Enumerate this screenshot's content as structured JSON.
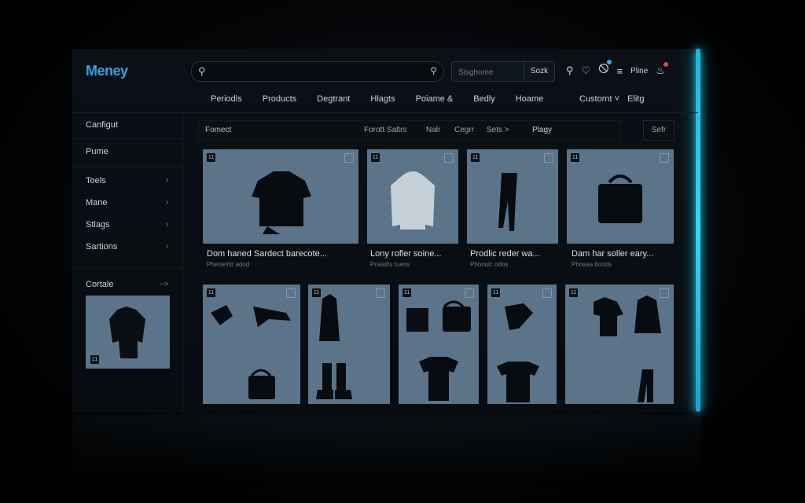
{
  "app": {
    "logo": "Meney"
  },
  "search": {
    "value": "",
    "placeholder": "",
    "alt_placeholder": "Sisghome",
    "alt_button": "Sozk"
  },
  "header_icons": [
    "search-icon",
    "heart-icon",
    "bag-icon",
    "list-icon",
    "bell-icon"
  ],
  "header": {
    "profile_label": "Pline"
  },
  "nav": {
    "items": [
      "Periodls",
      "Products",
      "Degtrant",
      "Hlagts",
      "Poiame &",
      "Bedly",
      "Hoame"
    ],
    "custom": "Custornt",
    "flag": "Elitg"
  },
  "sidebar": {
    "top_items": [
      "Canfigut",
      "Pume"
    ],
    "items": [
      {
        "label": "Toels"
      },
      {
        "label": "Mane"
      },
      {
        "label": "Stlags"
      },
      {
        "label": "Sartions"
      }
    ],
    "promo_title": "Cortale",
    "promo_arrow": "-->",
    "promo_tag": "11"
  },
  "filterbar": {
    "left": "Fomect",
    "filters": [
      "Forott Saltrs",
      "Nalr",
      "Cegrr",
      "Sets >"
    ],
    "dropdown": "Plagy",
    "sort": "Sefr"
  },
  "products_row1": [
    {
      "title": "Dom haned Sardect barecote...",
      "sub": "Pheoemtt adod",
      "tag": "11"
    },
    {
      "title": "Lony rofler soine...",
      "sub": "Poasitts tueos",
      "tag": "11"
    },
    {
      "title": "Prodlic reder wa...",
      "sub": "Phooulc odos",
      "tag": "11"
    },
    {
      "title": "Dam har soller eary...",
      "sub": "Phosaa boods",
      "tag": "11"
    }
  ],
  "products_row2": [
    {
      "tag": "11"
    },
    {
      "tag": "11"
    },
    {
      "tag": "11"
    },
    {
      "tag": "11"
    },
    {
      "tag": "11"
    }
  ],
  "colors": {
    "accent": "#2fa4e0",
    "glow": "#36d6f4",
    "card": "#5b7489",
    "badge": "#e04a3a"
  }
}
